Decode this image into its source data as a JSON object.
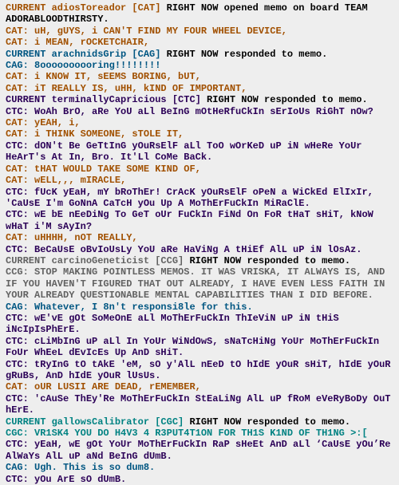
{
  "colors": {
    "CAT": "#a15000",
    "CAG": "#005682",
    "CTC": "#2b0057",
    "CCG": "#626262",
    "CGC": "#008282",
    "background": "#eeeeee"
  },
  "lines": [
    {
      "who": "CAT",
      "text": "CURRENT adiosToreador [CAT]",
      "sys": " RIGHT NOW opened memo on board TEAM ADORABLOODTHIRSTY."
    },
    {
      "who": "CAT",
      "text": "CAT: uH, gUYS, i CAN'T FIND MY FOUR WHEEL DEVICE,"
    },
    {
      "who": "CAT",
      "text": "CAT: i MEAN, rOCKETCHAIR,"
    },
    {
      "who": "CAG",
      "text": "CURRENT arachnidsGrip [CAG]",
      "sys": " RIGHT NOW responded to memo."
    },
    {
      "who": "CAG",
      "text": "CAG: 8oooooooooring!!!!!!!!"
    },
    {
      "who": "CAT",
      "text": "CAT: i KNOW IT, sEEMS BORING, bUT,"
    },
    {
      "who": "CAT",
      "text": "CAT: iT REALLY IS, uHH, kIND OF IMPORTANT,"
    },
    {
      "who": "CTC",
      "text": "CURRENT terminallyCapricious [CTC]",
      "sys": " RIGHT NOW responded to memo."
    },
    {
      "who": "CTC",
      "text": "CTC: WoAh BrO, aRe YoU aLl BeInG mOtHeRfuCkIn sErIoUs RiGhT nOw?"
    },
    {
      "who": "CAT",
      "text": "CAT: yEAH, i,"
    },
    {
      "who": "CAT",
      "text": "CAT: i THINK SOMEONE, sTOLE IT,"
    },
    {
      "who": "CTC",
      "text": "CTC: dON't Be GeTtInG yOuRsElF aLl ToO wOrKeD uP iN wHeRe YoUr HeArT's At In, Bro. It'Ll CoMe BaCk."
    },
    {
      "who": "CAT",
      "text": "CAT: tHAT WOULD TAKE SOME KIND OF,"
    },
    {
      "who": "CAT",
      "text": "CAT: wELL,,, mIRACLE,"
    },
    {
      "who": "CTC",
      "text": "CTC: fUcK yEaH, mY bRoThEr! CrAcK yOuRsElF oPeN a WiCkEd ElIxIr, 'CaUsE I'm GoNnA CaTcH yOu Up A MoThErFuCkIn MiRaClE."
    },
    {
      "who": "CTC",
      "text": "CTC: wE bE nEeDiNg To GeT oUr FuCkIn FiNd On FoR tHaT sHiT, kNoW wHaT i'M sAyIn?"
    },
    {
      "who": "CAT",
      "text": "CAT: uHHHH, nOT REALLY,"
    },
    {
      "who": "CTC",
      "text": "CTC: BeCaUsE oBvIoUsLy YoU aRe HaViNg A tHiEf AlL uP iN lOsAz."
    },
    {
      "who": "CCG",
      "text": "CURRENT carcinoGeneticist [CCG]",
      "sys": " RIGHT NOW responded to memo."
    },
    {
      "who": "CCG",
      "text": "CCG: STOP MAKING POINTLESS MEMOS. IT WAS VRISKA, IT ALWAYS IS, AND IF YOU HAVEN'T FIGURED THAT OUT ALREADY, I HAVE EVEN LESS FAITH IN YOUR ALREADY QUESTIONABLE MENTAL CAPABILITIES THAN I DID BEFORE."
    },
    {
      "who": "CAG",
      "text": "CAG: Whatever, I 8n't responsi8le for this."
    },
    {
      "who": "CTC",
      "text": "CTC: wE'vE gOt SoMeOnE aLl MoThErFuCkIn ThIeViN uP iN tHiS iNcIpIsPhErE."
    },
    {
      "who": "CTC",
      "text": "CTC: cLiMbInG uP aLl In YoUr WiNdOwS, sNaTcHiNg YoUr MoThErFuCkIn FoUr WhEeL dEvIcEs Up AnD sHiT."
    },
    {
      "who": "CTC",
      "text": "CTC: tRyInG tO tAkE 'eM, sO y'AlL nEeD tO hIdE yOuR sHiT, hIdE yOuR gRuBs, AnD hIdE yOuR lUsUs."
    },
    {
      "who": "CAT",
      "text": "CAT: oUR LUSII ARE DEAD, rEMEMBER,"
    },
    {
      "who": "CTC",
      "text": "CTC: 'cAuSe ThEy'Re MoThErFuCkIn StEaLiNg AlL uP fRoM eVeRyBoDy OuT hErE."
    },
    {
      "who": "CGC",
      "text": "CURRENT gallowsCalibrator [CGC]",
      "sys": " RIGHT NOW responded to memo."
    },
    {
      "who": "CGC",
      "text": "CGC: VR1SK4 YOU DO H4V3 4 R3PUT4T1ON FOR TH1S K1ND OF TH1NG >:["
    },
    {
      "who": "CTC",
      "text": "CTC: yEaH, wE gOt YoUr MoThErFuCkIn RaP sHeEt AnD aLl ‘CaUsE yOu’Re AlWaYs AlL uP aNd BeInG dUmB."
    },
    {
      "who": "CAG",
      "text": "CAG: Ugh. This is so dum8."
    },
    {
      "who": "CTC",
      "text": "CTC: yOu ArE sO dUmB."
    }
  ]
}
